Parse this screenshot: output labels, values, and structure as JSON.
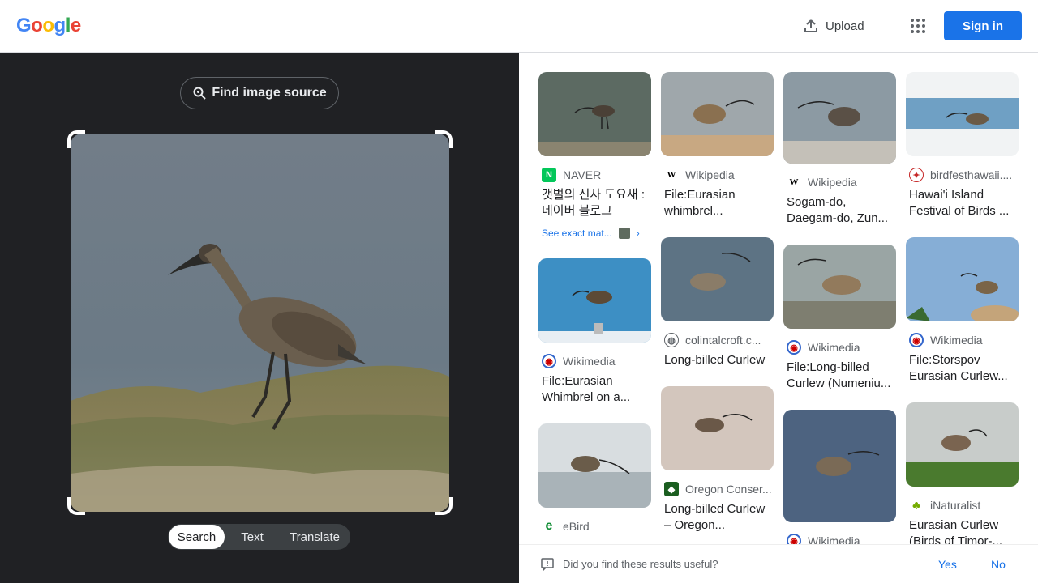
{
  "header": {
    "logo": [
      "G",
      "o",
      "o",
      "g",
      "l",
      "e"
    ],
    "logo_colors": [
      "#4285f4",
      "#ea4335",
      "#fbbc05",
      "#4285f4",
      "#34a853",
      "#ea4335"
    ],
    "upload_label": "Upload",
    "signin_label": "Sign in"
  },
  "left": {
    "find_source_label": "Find image source",
    "modes": [
      "Search",
      "Text",
      "Translate"
    ],
    "active_mode": "Search"
  },
  "results": {
    "col1": [
      {
        "source": "NAVER",
        "title": "갯벌의 신사 도요새 : 네이버 블로그",
        "exact": "See exact mat..."
      },
      {
        "source": "Wikimedia",
        "title": "File:Eurasian Whimbrel on a..."
      },
      {
        "source": "eBird",
        "title": ""
      }
    ],
    "col2": [
      {
        "source": "Wikipedia",
        "title": "File:Eurasian whimbrel..."
      },
      {
        "source": "colintalcroft.c...",
        "title": "Long-billed Curlew"
      },
      {
        "source": "Oregon Conser...",
        "title": "Long-billed Curlew – Oregon..."
      }
    ],
    "col3": [
      {
        "source": "Wikipedia",
        "title": "Sogam-do, Daegam-do, Zun..."
      },
      {
        "source": "Wikimedia",
        "title": "File:Long-billed Curlew (Numeniu..."
      },
      {
        "source": "Wikimedia",
        "title": ""
      }
    ],
    "col4": [
      {
        "source": "birdfesthawaii....",
        "title": "Hawai'i Island Festival of Birds ..."
      },
      {
        "source": "Wikimedia",
        "title": "File:Storspov Eurasian Curlew..."
      },
      {
        "source": "iNaturalist",
        "title": "Eurasian Curlew (Birds of Timor-..."
      }
    ]
  },
  "feedback": {
    "question": "Did you find these results useful?",
    "yes": "Yes",
    "no": "No"
  }
}
